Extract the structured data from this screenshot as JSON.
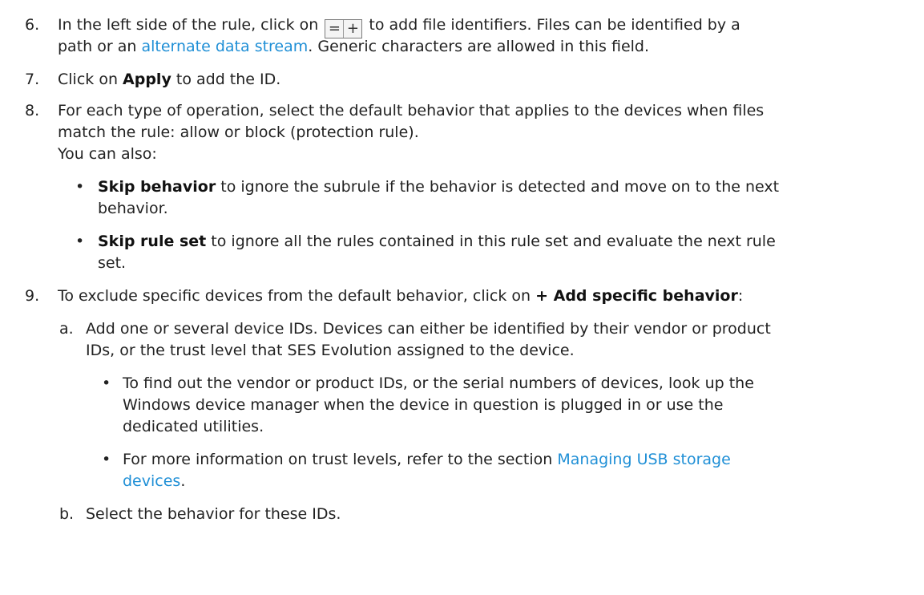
{
  "steps": {
    "s6": {
      "num": "6.",
      "line1_pre": "In the left side of the rule, click on",
      "line1_post": "to add file identifiers. Files can be identified by a",
      "line2_pre": "path or an",
      "line2_link": "alternate data stream",
      "line2_post": ". Generic characters are allowed in this field.",
      "icon_eq": "=",
      "icon_plus": "+"
    },
    "s7": {
      "num": "7.",
      "pre": "Click on",
      "bold": "Apply",
      "post": "to add the ID."
    },
    "s8": {
      "num": "8.",
      "line1": "For each type of operation, select the default behavior that applies to the devices when files",
      "line2": "match the rule: allow or block (protection rule).",
      "line3": "You can also:",
      "b1_bold": "Skip behavior",
      "b1_l1": "to ignore the subrule if the behavior is detected and move on to the next",
      "b1_l2": "behavior.",
      "b2_bold": "Skip rule set",
      "b2_l1": "to ignore all the rules contained in this rule set and evaluate the next rule",
      "b2_l2": "set."
    },
    "s9": {
      "num": "9.",
      "pre": "To exclude specific devices from the default behavior, click on",
      "bold": "+ Add specific behavior",
      "post": ":",
      "a_num": "a.",
      "a_l1": "Add one or several device IDs. Devices can either be identified by their vendor or product",
      "a_l2": "IDs, or the trust level that SES Evolution assigned to the device.",
      "a_b1_l1": "To find out the vendor or product IDs, or the serial numbers of devices, look up the",
      "a_b1_l2": "Windows device manager when the device in question is plugged in or use the",
      "a_b1_l3": "dedicated utilities.",
      "a_b2_pre": "For more information on trust levels, refer to the section",
      "a_b2_link1": "Managing USB storage",
      "a_b2_link2": "devices",
      "a_b2_post": ".",
      "b_num": "b.",
      "b_text": "Select the behavior for these IDs."
    }
  },
  "colors": {
    "link": "#1f8fd6",
    "text": "#222222"
  },
  "bullet_glyph": "•"
}
